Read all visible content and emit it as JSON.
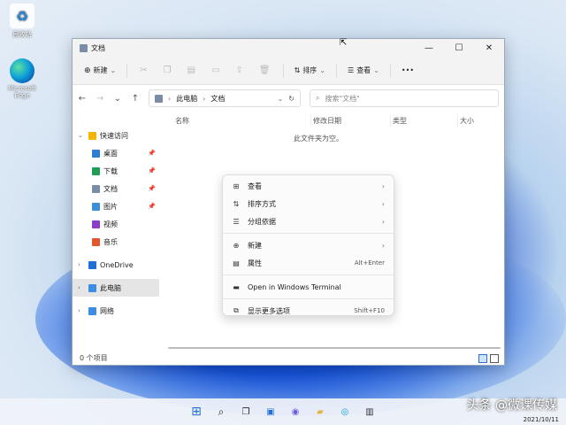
{
  "desktop": {
    "icons": [
      {
        "label": "回收站",
        "icon": "recycle-bin-icon"
      },
      {
        "label": "Microsoft Edge",
        "icon": "edge-icon"
      }
    ]
  },
  "window": {
    "title": "文档",
    "controls": {
      "minimize": "—",
      "maximize": "☐",
      "close": "✕"
    }
  },
  "toolbar": {
    "new_label": "新建",
    "sort_label": "排序",
    "view_label": "查看",
    "more_label": "•••"
  },
  "address": {
    "parts": [
      "此电脑",
      "文档"
    ],
    "separator": "›",
    "search_placeholder": "搜索\"文档\""
  },
  "sidebar": {
    "items": [
      {
        "label": "快速访问",
        "icon": "star-icon",
        "color": "#f4b400",
        "level": 0,
        "expand": "⌄"
      },
      {
        "label": "桌面",
        "icon": "desktop-icon",
        "color": "#2d7dd2",
        "level": 1,
        "pinned": true
      },
      {
        "label": "下载",
        "icon": "download-icon",
        "color": "#1f9d55",
        "level": 1,
        "pinned": true
      },
      {
        "label": "文档",
        "icon": "document-icon",
        "color": "#7b8da6",
        "level": 1,
        "pinned": true
      },
      {
        "label": "图片",
        "icon": "pictures-icon",
        "color": "#3b8fd9",
        "level": 1,
        "pinned": true
      },
      {
        "label": "视频",
        "icon": "video-icon",
        "color": "#8a3ec9",
        "level": 1
      },
      {
        "label": "音乐",
        "icon": "music-icon",
        "color": "#e4572e",
        "level": 1
      },
      {
        "label": "OneDrive",
        "icon": "cloud-icon",
        "color": "#1e6fd9",
        "level": 0,
        "expand": "›"
      },
      {
        "label": "此电脑",
        "icon": "computer-icon",
        "color": "#3a8ee6",
        "level": 0,
        "expand": "›",
        "selected": true
      },
      {
        "label": "网络",
        "icon": "network-icon",
        "color": "#3a8ee6",
        "level": 0,
        "expand": "›"
      }
    ]
  },
  "columns": {
    "name": "名称",
    "modified": "修改日期",
    "type": "类型",
    "size": "大小"
  },
  "empty_text": "此文件夹为空。",
  "status": {
    "count": "0 个项目"
  },
  "context_menu": {
    "items": [
      {
        "label": "查看",
        "icon": "grid-icon",
        "submenu": true
      },
      {
        "label": "排序方式",
        "icon": "sort-icon",
        "submenu": true
      },
      {
        "label": "分组依据",
        "icon": "group-icon",
        "submenu": true
      },
      {
        "separator": true
      },
      {
        "label": "新建",
        "icon": "plus-circle-icon",
        "submenu": true
      },
      {
        "label": "属性",
        "icon": "properties-icon",
        "shortcut": "Alt+Enter"
      },
      {
        "separator": true
      },
      {
        "label": "Open in Windows Terminal",
        "icon": "terminal-icon"
      },
      {
        "separator": true
      },
      {
        "label": "显示更多选项",
        "icon": "more-options-icon",
        "shortcut": "Shift+F10"
      }
    ]
  },
  "taskbar": {
    "apps": [
      "start-icon",
      "search-icon",
      "task-view-icon",
      "widgets-icon",
      "chat-icon",
      "file-explorer-icon",
      "edge-icon",
      "store-icon"
    ]
  },
  "watermark": "头条 @微课传媒",
  "clock": {
    "date": "2021/10/11"
  }
}
